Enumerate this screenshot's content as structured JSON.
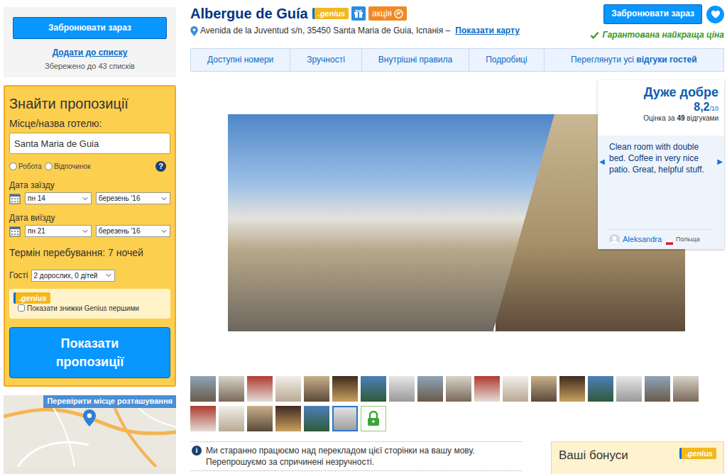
{
  "sidebar": {
    "book_button": "Забронювати зараз",
    "add_to_list": "Додати до списку",
    "saved_count": "Збережено до 43 списків",
    "search": {
      "title": "Знайти пропозиції",
      "destination_label": "Місце/назва готелю:",
      "destination_value": "Santa Maria de Guia",
      "purpose": [
        {
          "label": "Робота",
          "selected": false
        },
        {
          "label": "Відпочинок",
          "selected": false
        }
      ],
      "help": "?",
      "checkin": {
        "label": "Дата заїзду",
        "day": "пн 14",
        "month": "березень '16"
      },
      "checkout": {
        "label": "Дата виїзду",
        "day": "пн 21",
        "month": "березень '16"
      },
      "stay": "Термін перебування: 7 ночей",
      "guests_label": "Гості",
      "guests_value": "2 дорослих, 0 дітей",
      "genius_badge": ".genius",
      "genius_checkbox": {
        "label": "Показати знижки Genius першими",
        "checked": false
      },
      "submit": "Показати пропозиції"
    },
    "map": {
      "title": "Перевірити місце розташування"
    }
  },
  "hotel": {
    "name": "Albergue de Guía",
    "badges": [
      {
        "kind": "genius",
        "text": ".genius"
      },
      {
        "kind": "gift"
      },
      {
        "kind": "deal",
        "text": "акція"
      }
    ],
    "address": "Avenida de la Juventud s/n, 35450 Santa Maria de Guia, Іспанія –",
    "show_map": "Показати карту",
    "book_button": "Забронювати зараз",
    "best_price": "Гарантована найкраща ціна"
  },
  "tabs": [
    {
      "label": "Доступні номери",
      "selected": false
    },
    {
      "label": "Зручності",
      "selected": false
    },
    {
      "label": "Внутрішні правила",
      "selected": false
    },
    {
      "label": "Подробиці",
      "selected": false
    },
    {
      "label": "Переглянути усі",
      "emphasis": "відгуки гостей",
      "selected": false
    }
  ],
  "score": {
    "word": "Дуже добре",
    "value": "8,2",
    "scale": "/10",
    "count_prefix": "Оцінка за",
    "count": "49",
    "count_suffix": "відгуками"
  },
  "review": {
    "text": "Clean room with double bed. Coffee in very nice patio. Great, helpful stuff.",
    "author": "Aleksandra",
    "country": "Польща",
    "prev": "◀",
    "next": "▶"
  },
  "thumbnails": [
    {
      "selected": false
    },
    {
      "selected": false
    },
    {
      "selected": false
    },
    {
      "selected": false
    },
    {
      "selected": false
    },
    {
      "selected": false
    },
    {
      "selected": false
    },
    {
      "selected": false
    },
    {
      "selected": false
    },
    {
      "selected": false
    },
    {
      "selected": false
    },
    {
      "selected": false
    },
    {
      "selected": false
    },
    {
      "selected": false
    },
    {
      "selected": false
    },
    {
      "selected": false
    },
    {
      "selected": false
    },
    {
      "selected": false
    },
    {
      "selected": false
    },
    {
      "selected": false
    },
    {
      "selected": false
    },
    {
      "selected": false
    },
    {
      "selected": false
    },
    {
      "selected": true
    }
  ],
  "notice": {
    "icon": "i",
    "text": "Ми старанно працюємо над перекладом цієї сторінки на вашу мову. Перепрошуємо за спричинені незручності."
  },
  "bonus": {
    "title": "Ваші бонуси",
    "badge": ".genius"
  }
}
